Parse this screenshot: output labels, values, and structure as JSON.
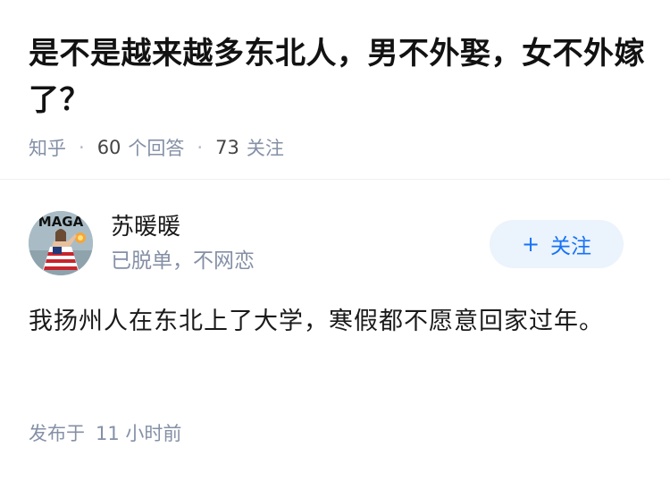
{
  "question": {
    "title": "是不是越来越多东北人，男不外娶，女不外嫁了？",
    "source": "知乎",
    "answer_count": "60",
    "answer_label": "个回答",
    "follower_count": "73",
    "follower_label": "关注"
  },
  "author": {
    "name": "苏暖暖",
    "bio": "已脱单，不网恋",
    "avatar_text": "MAGA",
    "avatar_icon": "avatar-photo"
  },
  "follow_button": {
    "icon": "+",
    "label": "关注"
  },
  "answer": {
    "text": "我扬州人在东北上了大学，寒假都不愿意回家过年。"
  },
  "footer": {
    "published_prefix": "发布于",
    "published_time": "11 小时前"
  },
  "colors": {
    "primary": "#1772f6",
    "button_bg": "#ebf3fc",
    "meta_gray": "#8590a6"
  }
}
